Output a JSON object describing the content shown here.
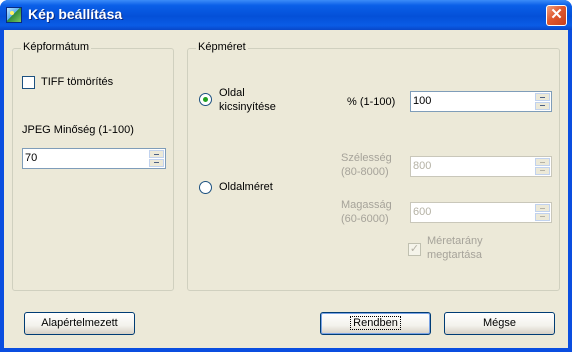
{
  "window": {
    "title": "Kép beállítása",
    "close_glyph": "✕",
    "title_icon": "picture-icon"
  },
  "format_group": {
    "label": "Képformátum",
    "tiff_label": "TIFF tömörítés",
    "tiff_checked": false,
    "jpeg_label": "JPEG Minőség (1-100)",
    "jpeg_value": "70"
  },
  "size_group": {
    "label": "Képméret",
    "reduce_option": {
      "label_line1": "Oldal",
      "label_line2": "kicsinyítése",
      "selected": true
    },
    "percent_label": "% (1-100)",
    "percent_value": "100",
    "pagesize_option": {
      "label": "Oldalméret",
      "selected": false
    },
    "width_label_line1": "Szélesség",
    "width_label_line2": "(80-8000)",
    "width_value": "800",
    "height_label_line1": "Magasság",
    "height_label_line2": "(60-6000)",
    "height_value": "600",
    "aspect_label_line1": "Méretarány",
    "aspect_label_line2": "megtartása",
    "aspect_checked": true,
    "aspect_check_glyph": "✓"
  },
  "buttons": {
    "default": "Alapértelmezett",
    "ok": "Rendben",
    "cancel": "Mégse"
  },
  "colors": {
    "titlebar": "#0450d8",
    "dialog_bg": "#ece9d8",
    "radio_dot": "#21a121",
    "close_button": "#e0582e"
  }
}
